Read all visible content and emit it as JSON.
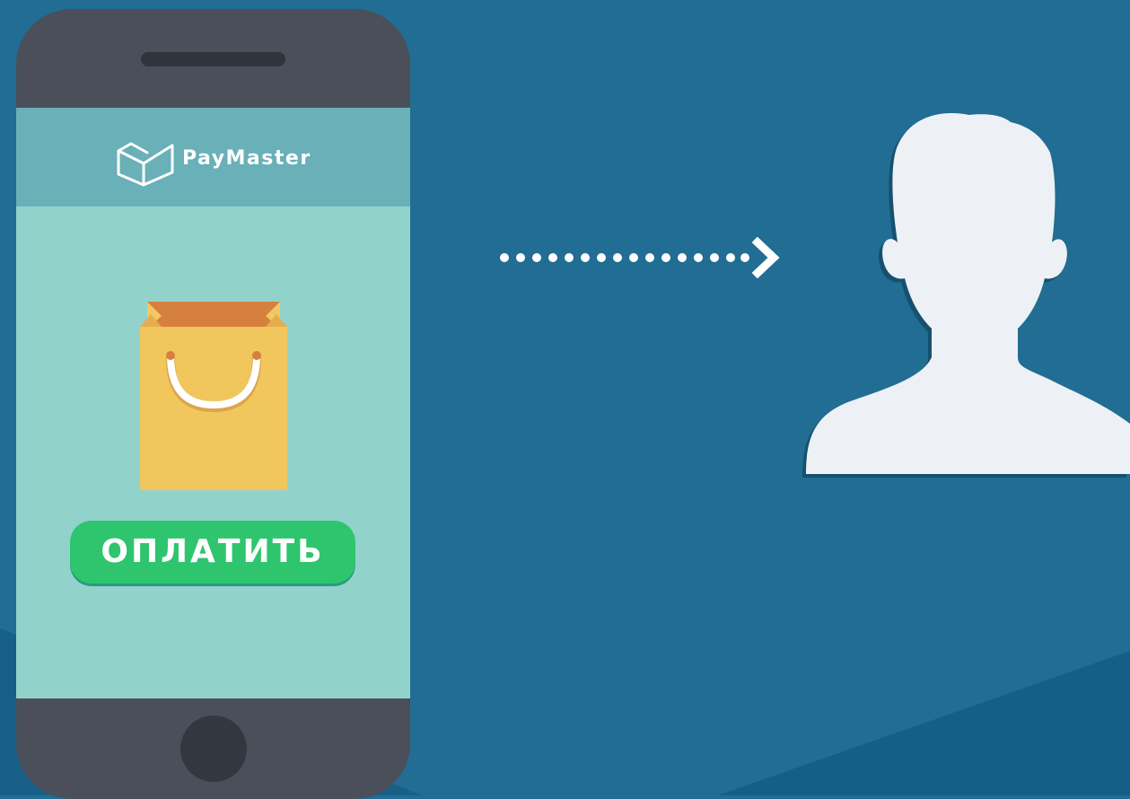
{
  "app": {
    "brand_name": "PayMaster",
    "logo_icon": "paymaster-logo-icon"
  },
  "checkout": {
    "product_icon": "shopping-bag-icon",
    "pay_button_label": "ОПЛАТИТЬ"
  },
  "flow": {
    "arrow_icon": "dotted-arrow-right-icon",
    "recipient_icon": "user-silhouette-icon"
  },
  "colors": {
    "background": "#216d93",
    "phone_body": "#4a4f59",
    "screen": "#91d3cb",
    "header": "#69b0b8",
    "pay_button": "#2ec56e",
    "bag": "#f0c65d",
    "user": "#edf1f5"
  }
}
